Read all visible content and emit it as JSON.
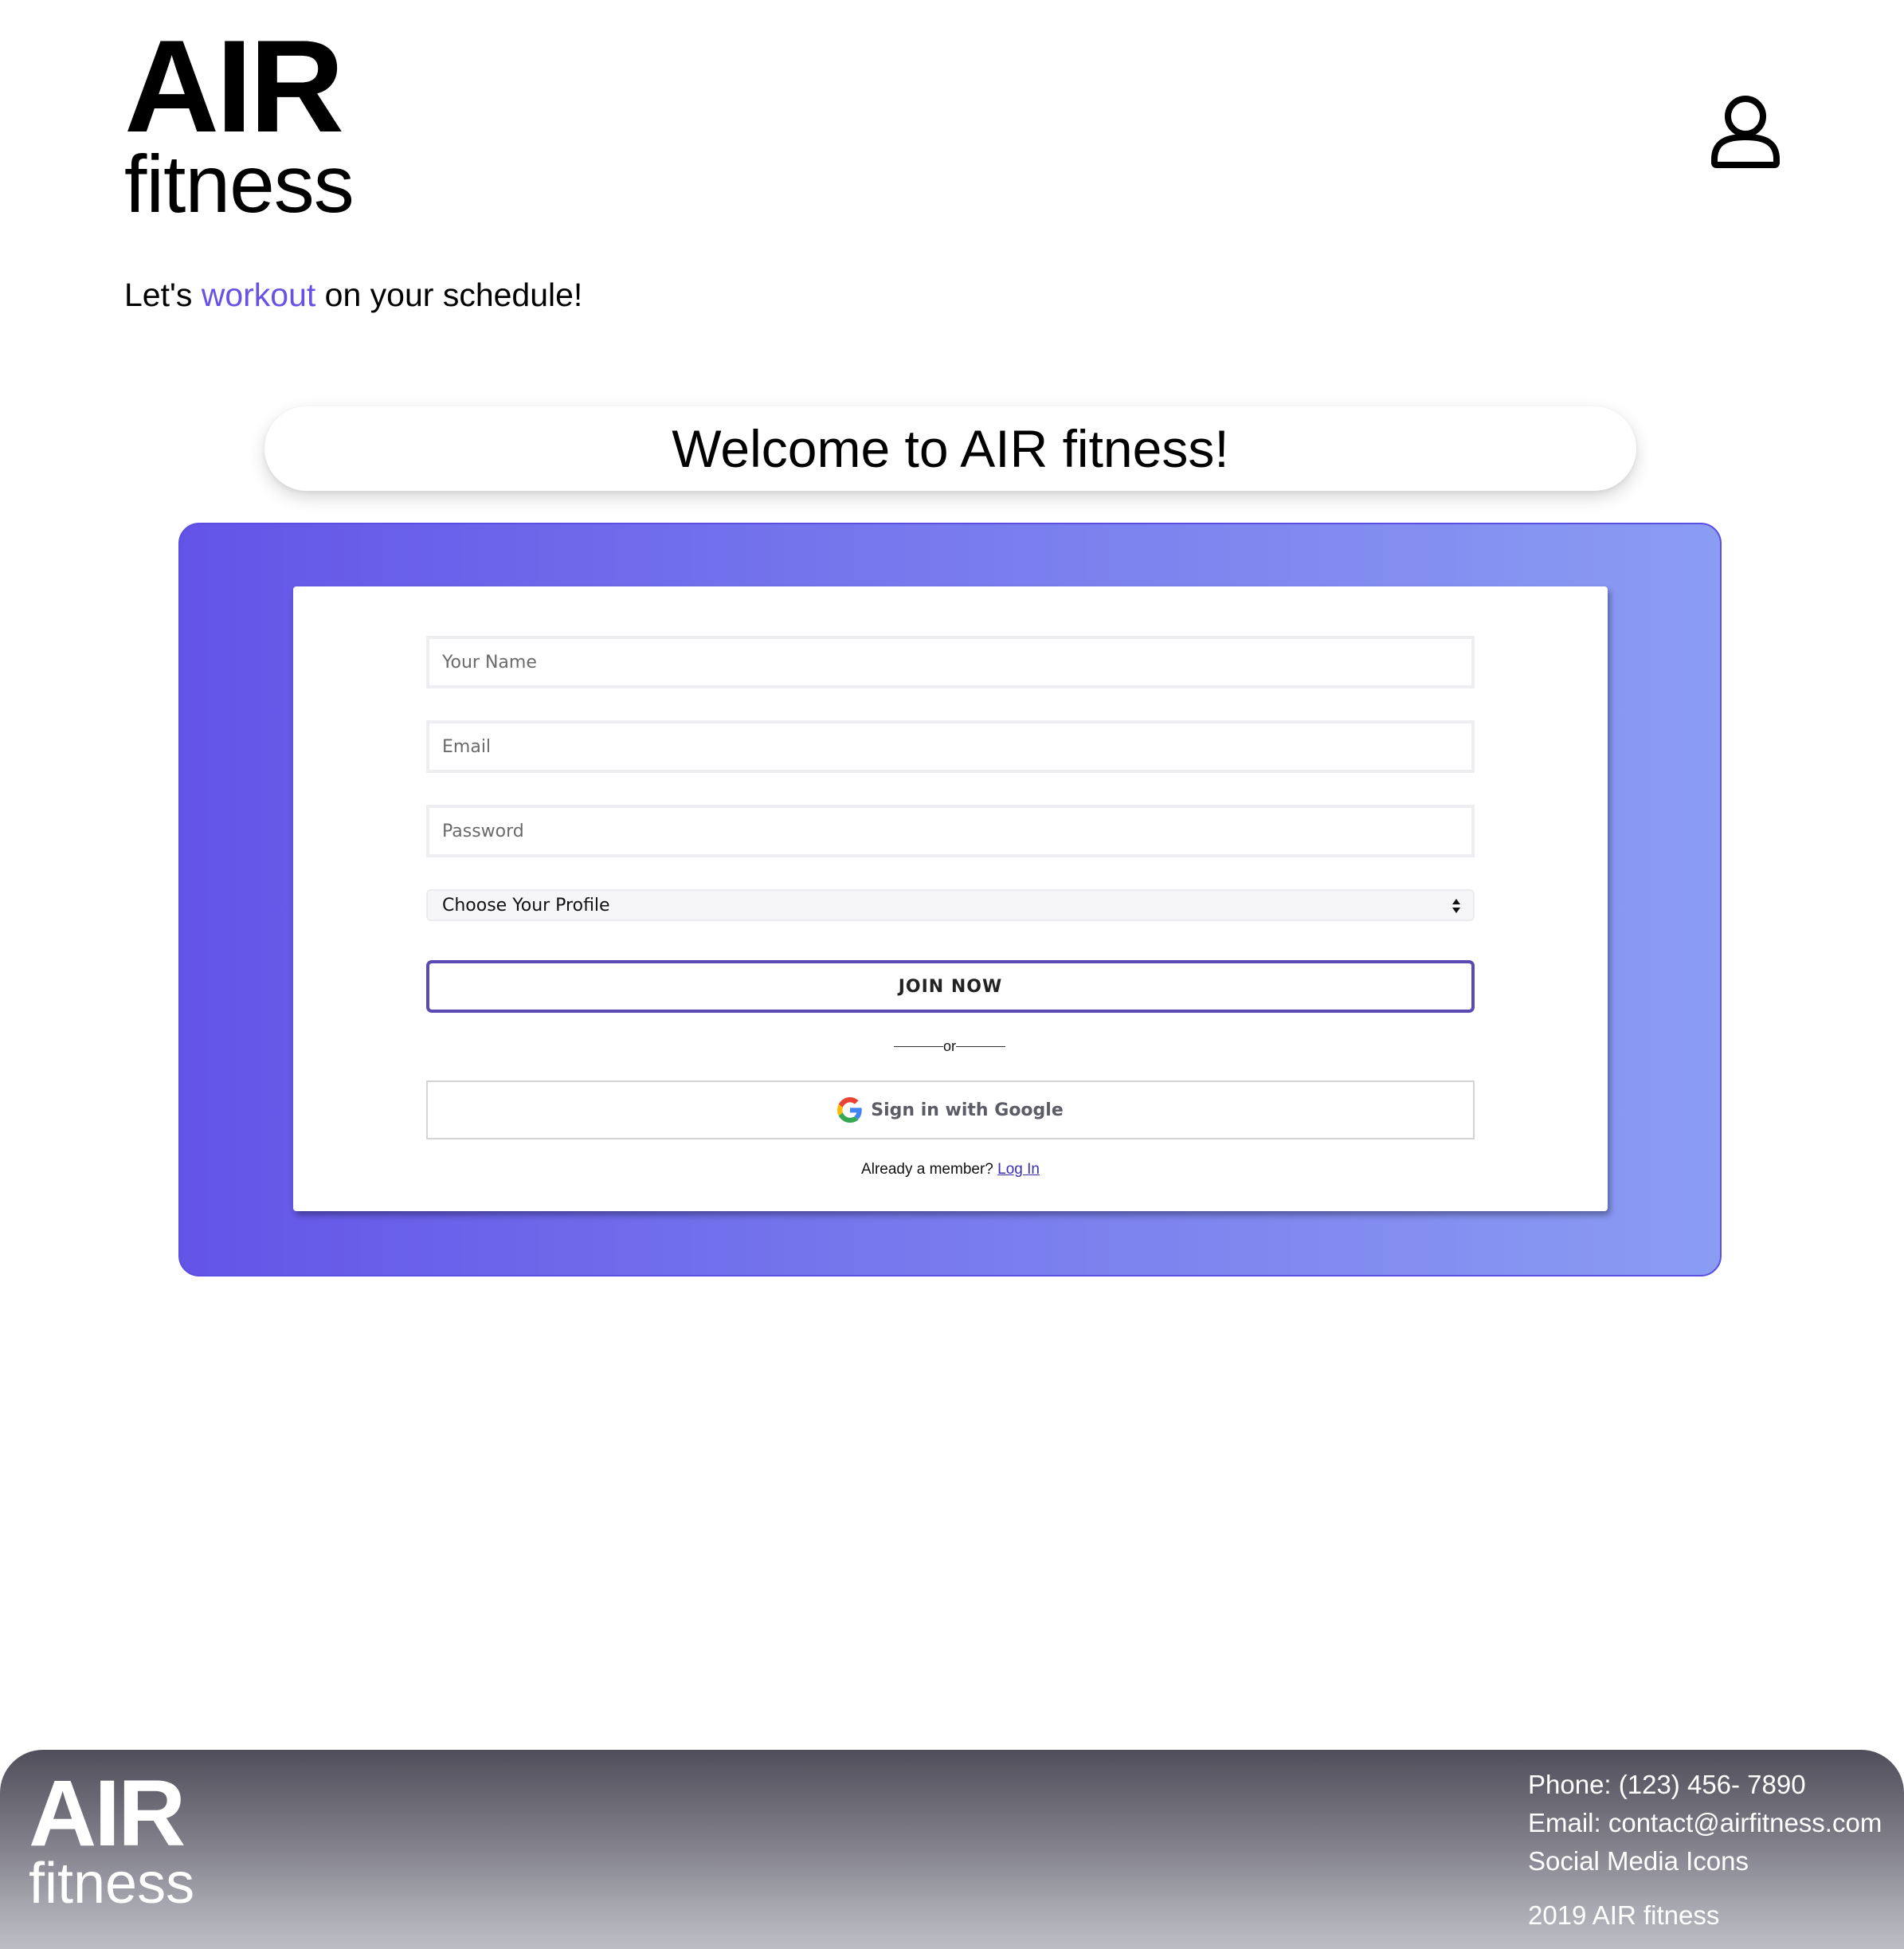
{
  "header": {
    "logo_main": "AIR",
    "logo_sub": "fitness",
    "tagline_before": "Let's ",
    "tagline_accent": "workout",
    "tagline_after": " on your schedule!",
    "account_icon": "user-icon"
  },
  "welcome": {
    "title": "Welcome to AIR fitness!"
  },
  "form": {
    "name_placeholder": "Your Name",
    "email_placeholder": "Email",
    "password_placeholder": "Password",
    "profile_select_value": "Choose Your Profile",
    "join_label": "JOIN NOW",
    "or_label": "or",
    "google_label": "Sign in with Google",
    "already_text": "Already a member? ",
    "login_link": "Log In"
  },
  "footer": {
    "logo_main": "AIR",
    "logo_sub": "fitness",
    "phone": "Phone: (123) 456- 7890",
    "email": "Email: contact@airfitness.com",
    "social": "Social Media Icons",
    "copyright": "2019 AIR fitness"
  },
  "colors": {
    "accent": "#6652e6",
    "panel_gradient_start": "#6354e8",
    "panel_gradient_end": "#8b9cf3",
    "join_border": "#5b49b5",
    "footer_top": "#4f4e5a",
    "footer_bottom": "#bdbdc4"
  }
}
